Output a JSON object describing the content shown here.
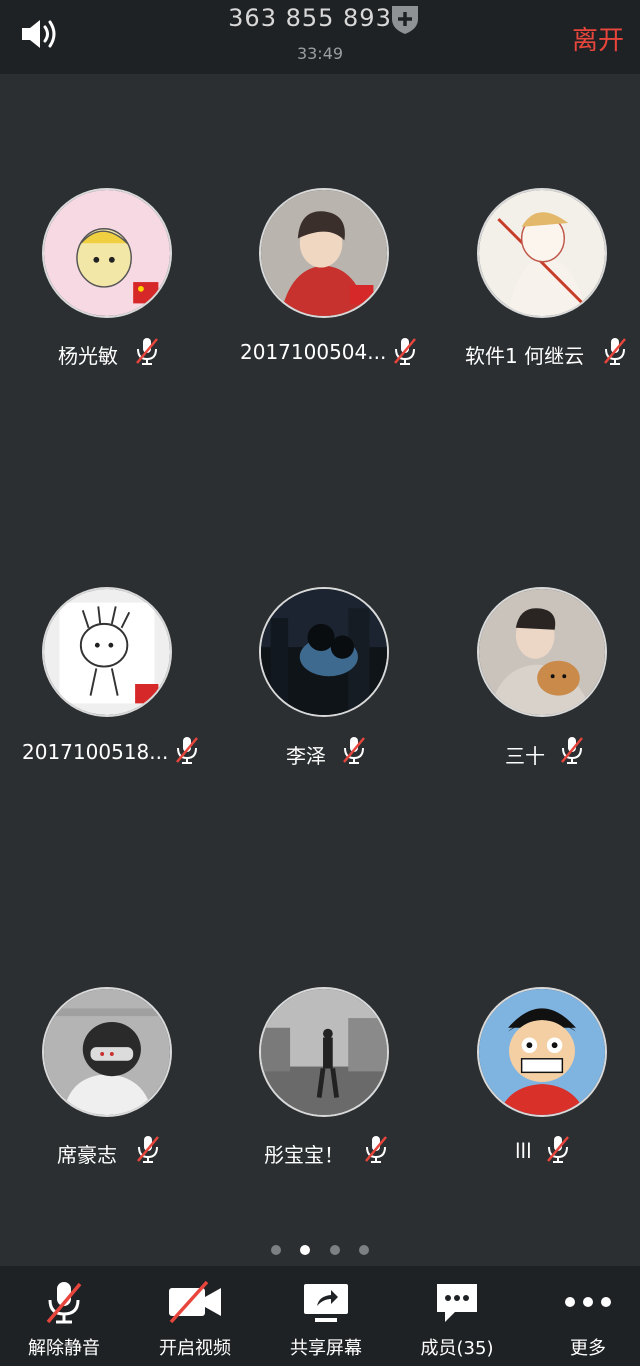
{
  "header": {
    "meeting_id": "363 855 893",
    "timer": "33:49",
    "leave_label": "离开"
  },
  "participants": [
    {
      "name": "杨光敏",
      "mic": "muted"
    },
    {
      "name": "2017100504...",
      "mic": "muted"
    },
    {
      "name": "软件1 何继云",
      "mic": "muted"
    },
    {
      "name": "2017100518...",
      "mic": "muted"
    },
    {
      "name": "李泽",
      "mic": "muted"
    },
    {
      "name": "三十",
      "mic": "muted"
    },
    {
      "name": "席豪志",
      "mic": "muted"
    },
    {
      "name": "彤宝宝！",
      "mic": "muted"
    },
    {
      "name": "lll",
      "mic": "muted"
    }
  ],
  "pager": {
    "pages": 4,
    "current": 2
  },
  "toolbar": {
    "unmute": "解除静音",
    "video": "开启视频",
    "share": "共享屏幕",
    "members": "成员(35)",
    "more": "更多"
  },
  "colors": {
    "accent_red": "#e8453c",
    "background": "#2b2f31",
    "bar": "#1f2224"
  }
}
